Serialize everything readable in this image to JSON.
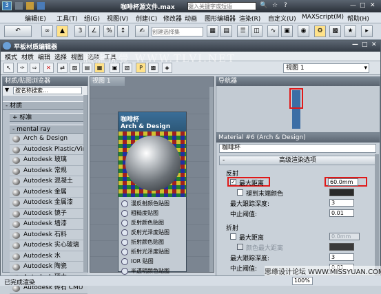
{
  "window": {
    "title": "咖啡杯源文件.max",
    "search_placeholder": "键入关键字或短语"
  },
  "menu": [
    "编辑(E)",
    "工具(T)",
    "组(G)",
    "视图(V)",
    "创建(C)",
    "修改器",
    "动画",
    "图形编辑器",
    "渲染(R)",
    "自定义(U)",
    "MAXScript(M)",
    "帮助(H)"
  ],
  "toolbar": {
    "selection_set_placeholder": "创建选择集"
  },
  "sme": {
    "title": "平板材质编辑器",
    "menu": [
      "模式",
      "材质",
      "编辑",
      "选择",
      "视图",
      "选项",
      "工具"
    ],
    "view_dropdown": "视图 1",
    "browser": {
      "header": "材质/贴图浏览器",
      "search": "按名称搜索...",
      "group_materials": "- 材质",
      "group_standard": "+ 标准",
      "group_mental_ray": "- mental ray",
      "items": [
        "Arch & Design",
        "Autodesk Plastic/Vinyl",
        "Autodesk 玻璃",
        "Autodesk 常规",
        "Autodesk 混凝土",
        "Autodesk 金属",
        "Autodesk 金属漆",
        "Autodesk 镜子",
        "Autodesk 墙漆",
        "Autodesk 石料",
        "Autodesk 实心玻璃",
        "Autodesk 水",
        "Autodesk 陶瓷",
        "Autodesk 硬木",
        "Autodesk 砖石 CMU"
      ]
    },
    "view": {
      "tab": "视图 1",
      "node_title": "咖啡杯",
      "node_subtitle": "Arch & Design",
      "slots": [
        "漫反射颜色贴图",
        "粗糙度贴图",
        "反射颜色贴图",
        "反射光泽度贴图",
        "折射颜色贴图",
        "折射光泽度贴图",
        "IOR 贴图",
        "半透明颜色贴图"
      ]
    },
    "navigator": {
      "header": "导航器"
    },
    "params": {
      "header": "Material #6 (Arch & Design)",
      "name": "咖啡杯",
      "rollout": "高级渲染选项",
      "reflection": {
        "group": "反射",
        "max_distance_label": "最大距离",
        "max_distance_value": "60.0mm",
        "max_distance_checked": true,
        "fade_end_label": "褪到末端颜色",
        "max_depth_label": "最大跟踪深度:",
        "max_depth_value": "3",
        "cutoff_label": "中止阈值:",
        "cutoff_value": "0.01"
      },
      "refraction": {
        "group": "折射",
        "max_distance_label": "最大距离",
        "max_distance_value": "0.0mm",
        "color_label": "颜色最大距离",
        "max_depth_label": "最大跟踪深度:",
        "max_depth_value": "3",
        "cutoff_label": "中止阈值:",
        "cutoff_value": "0.01"
      }
    },
    "status": {
      "left": "已完成渲染",
      "zoom": "100%"
    }
  },
  "watermark": "騰龍視覺 WWW.TLVI.NET",
  "watermark2": "思缘设计论坛 WWW.MISSYUAN.COM",
  "colors": {
    "accent": "#3c6ea5",
    "highlight": "#e01818"
  }
}
